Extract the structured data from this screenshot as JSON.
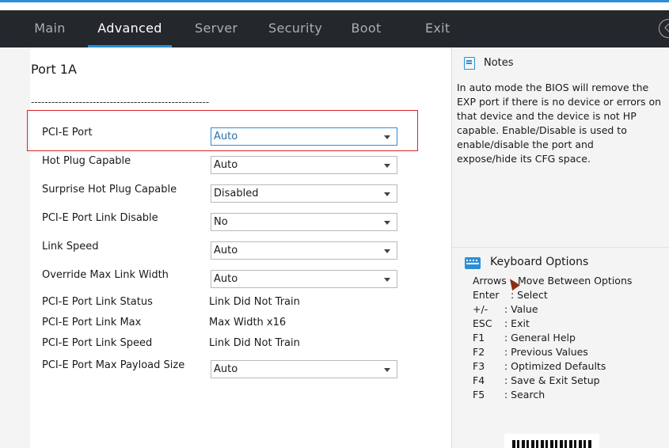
{
  "nav": {
    "tabs": [
      {
        "label": "Main"
      },
      {
        "label": "Advanced"
      },
      {
        "label": "Server"
      },
      {
        "label": "Security"
      },
      {
        "label": "Boot"
      },
      {
        "label": "Exit"
      }
    ],
    "active_tab": "Advanced"
  },
  "main": {
    "title": "Port 1A",
    "separator": "----------------------------------------------------",
    "settings": [
      {
        "label": "PCI-E Port",
        "value": "Auto",
        "type": "dropdown",
        "highlighted": true
      },
      {
        "label": "Hot Plug Capable",
        "value": "Auto",
        "type": "dropdown"
      },
      {
        "label": "Surprise Hot Plug Capable",
        "value": "Disabled",
        "type": "dropdown"
      },
      {
        "label": "PCI-E Port Link Disable",
        "value": "No",
        "type": "dropdown"
      },
      {
        "label": "Link Speed",
        "value": "Auto",
        "type": "dropdown"
      },
      {
        "label": "Override Max Link Width",
        "value": "Auto",
        "type": "dropdown"
      },
      {
        "label": "PCI-E Port Link Status",
        "value": "Link Did Not Train",
        "type": "text"
      },
      {
        "label": "PCI-E Port Link Max",
        "value": "Max Width x16",
        "type": "text"
      },
      {
        "label": "PCI-E Port Link Speed",
        "value": "Link Did Not Train",
        "type": "text"
      },
      {
        "label": "PCI-E Port Max Payload Size",
        "value": "Auto",
        "type": "dropdown"
      }
    ]
  },
  "notes": {
    "title": "Notes",
    "lines": [
      "In auto mode the BIOS will remove the",
      "EXP port if there is no device or errors on",
      "that device and the device is not HP",
      "capable.  Enable/Disable is used to",
      "enable/disable the port and",
      "expose/hide its CFG space."
    ]
  },
  "keyboard": {
    "title": "Keyboard Options",
    "items": [
      {
        "key": "Arrows",
        "desc": "Move Between Options"
      },
      {
        "key": "Enter",
        "desc": ": Select"
      },
      {
        "key": "+/-",
        "desc": ": Value"
      },
      {
        "key": "ESC",
        "desc": ": Exit"
      },
      {
        "key": "F1",
        "desc": ": General Help"
      },
      {
        "key": "F2",
        "desc": ": Previous Values"
      },
      {
        "key": "F3",
        "desc": ": Optimized Defaults"
      },
      {
        "key": "F4",
        "desc": ": Save & Exit Setup"
      },
      {
        "key": "F5",
        "desc": ": Search"
      }
    ]
  },
  "colors": {
    "navbar_bg": "#24282d",
    "accent": "#2a8fd6",
    "highlight_border": "#d9262b"
  }
}
